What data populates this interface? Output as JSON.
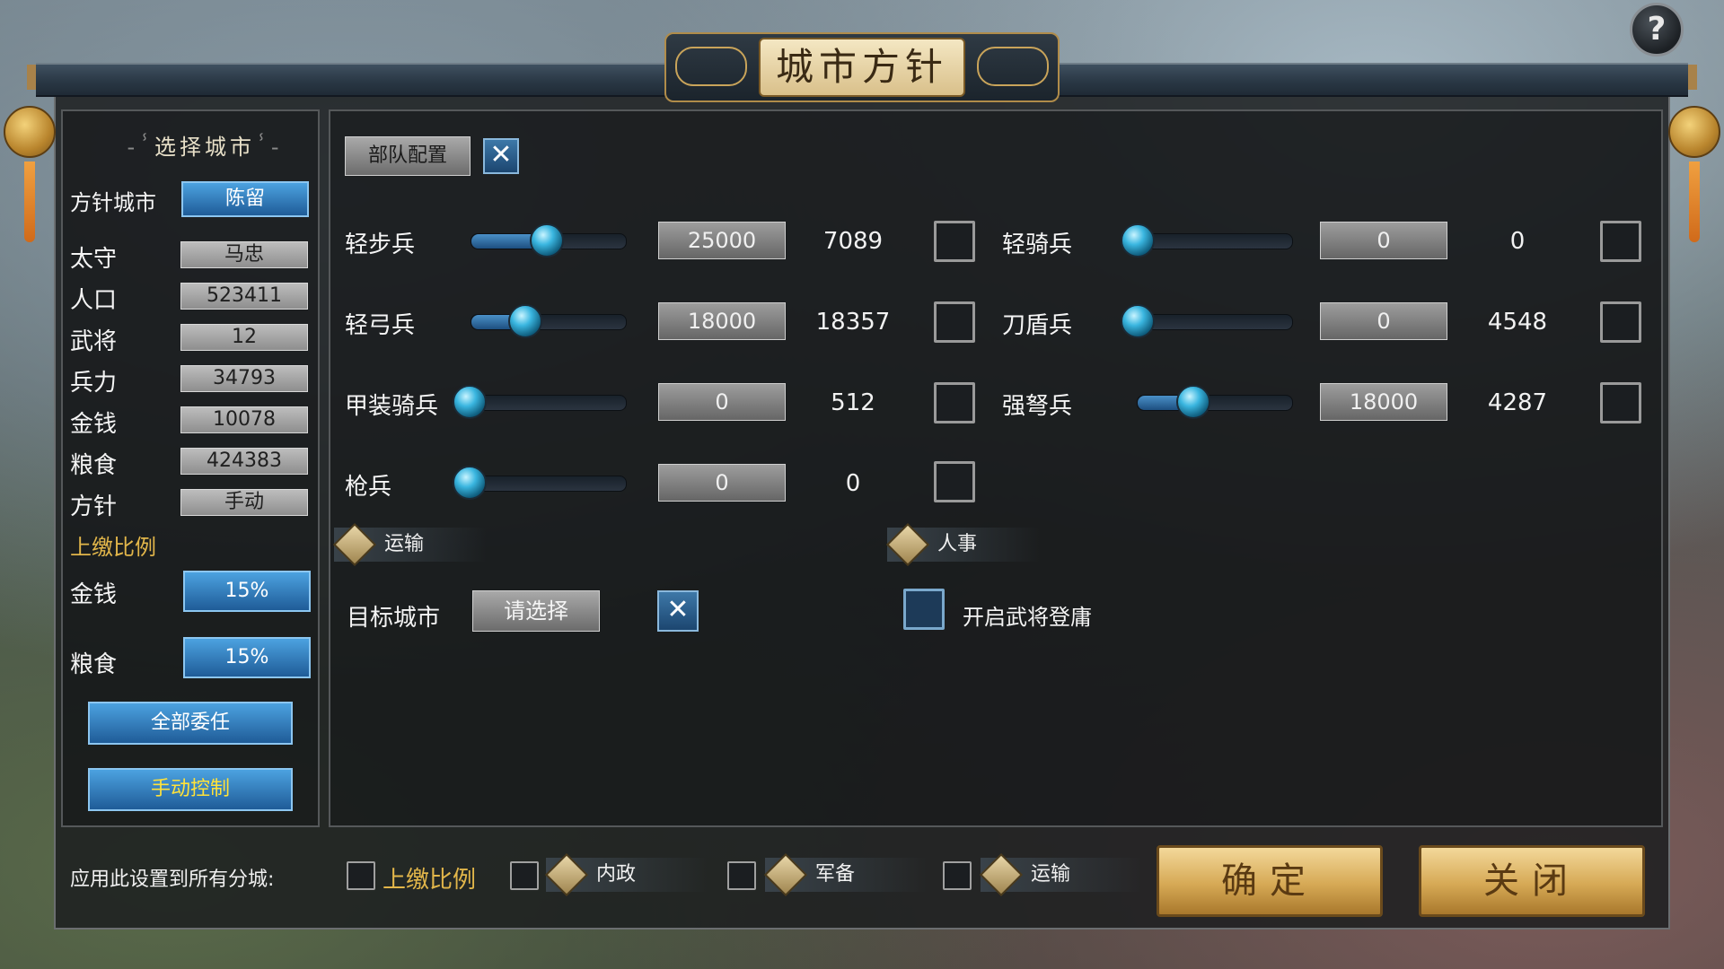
{
  "title": "城市方针",
  "help_label": "?",
  "left": {
    "section_title": "选择城市",
    "policy_city_label": "方针城市",
    "policy_city_value": "陈留",
    "stats": [
      {
        "label": "太守",
        "value": "马忠"
      },
      {
        "label": "人口",
        "value": "523411"
      },
      {
        "label": "武将",
        "value": "12"
      },
      {
        "label": "兵力",
        "value": "34793"
      },
      {
        "label": "金钱",
        "value": "10078"
      },
      {
        "label": "粮食",
        "value": "424383"
      },
      {
        "label": "方针",
        "value": "手动"
      }
    ],
    "tribute_title": "上缴比例",
    "tribute": [
      {
        "label": "金钱",
        "value": "15%"
      },
      {
        "label": "粮食",
        "value": "15%"
      }
    ],
    "delegate_all_label": "全部委任",
    "manual_control_label": "手动控制"
  },
  "content": {
    "troop_config_label": "部队配置",
    "close_glyph": "✕",
    "troops_left": [
      {
        "name": "轻步兵",
        "target": "25000",
        "count": "7089",
        "slider": 0.45
      },
      {
        "name": "轻弓兵",
        "target": "18000",
        "count": "18357",
        "slider": 0.32
      },
      {
        "name": "甲装骑兵",
        "target": "0",
        "count": "512",
        "slider": 0.0
      },
      {
        "name": "枪兵",
        "target": "0",
        "count": "0",
        "slider": 0.0
      }
    ],
    "troops_right": [
      {
        "name": "轻骑兵",
        "target": "0",
        "count": "0",
        "slider": 0.0
      },
      {
        "name": "刀盾兵",
        "target": "0",
        "count": "4548",
        "slider": 0.0
      },
      {
        "name": "强弩兵",
        "target": "18000",
        "count": "4287",
        "slider": 0.36
      }
    ],
    "transport_tab": "运输",
    "personnel_tab": "人事",
    "target_city_label": "目标城市",
    "target_city_select": "请选择",
    "enable_promotion_label": "开启武将登庸"
  },
  "bottom": {
    "apply_all_label": "应用此设置到所有分城:",
    "options": [
      "上缴比例",
      "内政",
      "军备",
      "运输"
    ],
    "confirm_label": "确定",
    "close_label": "关闭"
  },
  "colors": {
    "gold_text": "#e2b64a",
    "blue_button": "#2f7ec0",
    "panel_bg": "#1c1e20"
  },
  "icons": [
    "question-icon",
    "close-icon",
    "cart-icon",
    "person-icon",
    "scroll-icon",
    "shield-icon"
  ]
}
